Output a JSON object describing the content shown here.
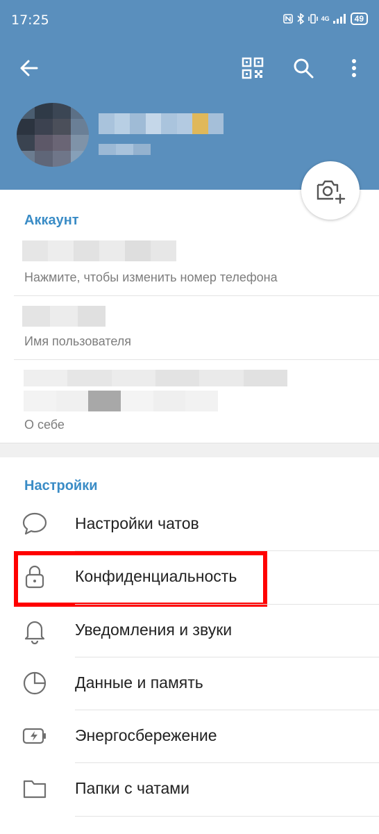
{
  "status_bar": {
    "time": "17:25",
    "network": "4G",
    "battery": "49"
  },
  "account": {
    "section_title": "Аккаунт",
    "phone_hint": "Нажмите, чтобы изменить номер телефона",
    "username_hint": "Имя пользователя",
    "bio_hint": "О себе"
  },
  "settings": {
    "section_title": "Настройки",
    "items": [
      {
        "label": "Настройки чатов",
        "icon": "chat-bubble-icon"
      },
      {
        "label": "Конфиденциальность",
        "icon": "lock-icon"
      },
      {
        "label": "Уведомления и звуки",
        "icon": "bell-icon"
      },
      {
        "label": "Данные и память",
        "icon": "pie-chart-icon"
      },
      {
        "label": "Энергосбережение",
        "icon": "battery-bolt-icon"
      },
      {
        "label": "Папки с чатами",
        "icon": "folder-icon"
      }
    ]
  },
  "colors": {
    "header": "#5a8fbd",
    "accent": "#3a8cc6",
    "highlight": "#ff0000"
  }
}
